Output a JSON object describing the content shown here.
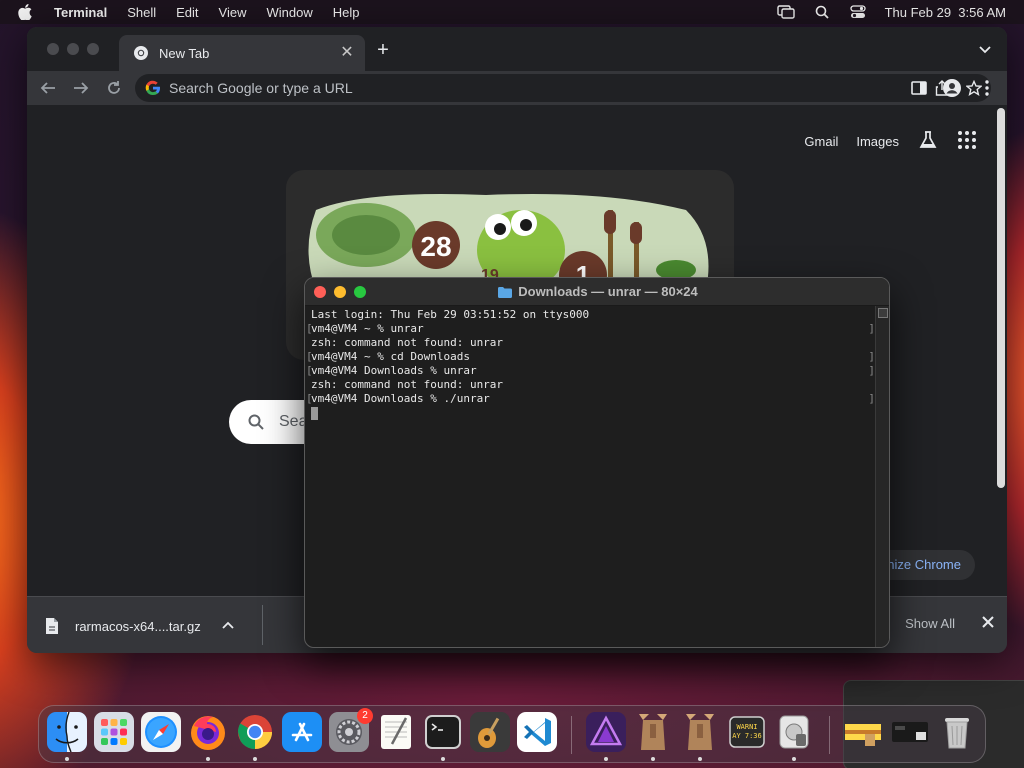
{
  "menubar": {
    "app_name": "Terminal",
    "items": [
      "Shell",
      "Edit",
      "View",
      "Window",
      "Help"
    ],
    "clock": "Thu Feb 29  3:56 AM"
  },
  "chrome": {
    "tab": {
      "title": "New Tab"
    },
    "omnibox": {
      "placeholder": "Search Google or type a URL"
    },
    "top_links": {
      "gmail": "Gmail",
      "images": "Images"
    },
    "search_partial": "Sea",
    "customize_label": "nize Chrome",
    "doodle": {
      "text_a": "28",
      "text_b": "1",
      "text_c": "19"
    },
    "downloads": {
      "file_name": "rarmacos-x64....tar.gz",
      "show_all": "Show All"
    }
  },
  "terminal": {
    "title": "Downloads — unrar — 80×24",
    "lines": [
      "Last login: Thu Feb 29 03:51:52 on ttys000",
      "vm4@VM4 ~ % unrar",
      "zsh: command not found: unrar",
      "vm4@VM4 ~ % cd Downloads",
      "vm4@VM4 Downloads % unrar",
      "zsh: command not found: unrar",
      "vm4@VM4 Downloads % ./unrar"
    ]
  },
  "dock": {
    "items": [
      {
        "name": "Finder",
        "icon": "finder-icon"
      },
      {
        "name": "Launchpad",
        "icon": "launchpad-icon"
      },
      {
        "name": "Safari",
        "icon": "safari-icon"
      },
      {
        "name": "Firefox",
        "icon": "firefox-icon"
      },
      {
        "name": "Google Chrome",
        "icon": "chrome-icon"
      },
      {
        "name": "App Store",
        "icon": "app-store-icon"
      },
      {
        "name": "System Settings",
        "icon": "settings-icon",
        "badge": "2"
      },
      {
        "name": "TextEdit",
        "icon": "textedit-icon"
      },
      {
        "name": "Terminal",
        "icon": "terminal-icon"
      },
      {
        "name": "GarageBand",
        "icon": "garageband-icon"
      },
      {
        "name": "Visual Studio Code",
        "icon": "vscode-icon"
      },
      {
        "name": "Affinity Photo",
        "icon": "affinity-icon"
      },
      {
        "name": "Archive Utility",
        "icon": "archive-icon"
      },
      {
        "name": "Archive Utility 2",
        "icon": "archive-icon"
      },
      {
        "name": "Console",
        "icon": "console-icon",
        "label": "WARNI\nAY 7:36"
      },
      {
        "name": "Disk Utility",
        "icon": "disk-utility-icon"
      },
      {
        "name": "Downloads Folder",
        "icon": "folder-stack-icon"
      },
      {
        "name": "Screenshot",
        "icon": "screenshot-icon"
      },
      {
        "name": "Trash",
        "icon": "trash-icon"
      }
    ]
  },
  "colors": {
    "chrome_bg": "#35363a",
    "page_bg": "#202124",
    "terminal_bg": "#1e1e1e",
    "link_blue": "#8ab4f8",
    "close_red": "#ff5f57",
    "minimize_yellow": "#febc2e",
    "zoom_green": "#28c840"
  }
}
